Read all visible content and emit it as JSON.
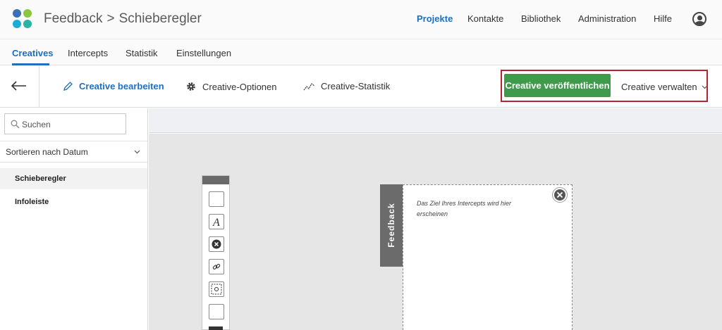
{
  "header": {
    "title_project": "Feedback",
    "title_separator": ">",
    "title_page": "Schieberegler",
    "nav": [
      "Projekte",
      "Kontakte",
      "Bibliothek",
      "Administration",
      "Hilfe"
    ]
  },
  "tabs": [
    "Creatives",
    "Intercepts",
    "Statistik",
    "Einstellungen"
  ],
  "toolbar": {
    "edit": "Creative bearbeiten",
    "options": "Creative-Optionen",
    "stats": "Creative-Statistik",
    "publish": "Creative veröffentlichen",
    "manage": "Creative verwalten"
  },
  "sidebar": {
    "search_placeholder": "Suchen",
    "sort_label": "Sortieren nach Datum",
    "items": [
      "Schieberegler",
      "Infoleiste"
    ]
  },
  "preview": {
    "tab_label": "Feedback",
    "placeholder_text": "Das Ziel Ihres Intercepts wird hier erscheinen"
  },
  "colors": {
    "accent": "#1e6fbf",
    "publish": "#3f9a4c",
    "highlight": "#b8232f"
  }
}
